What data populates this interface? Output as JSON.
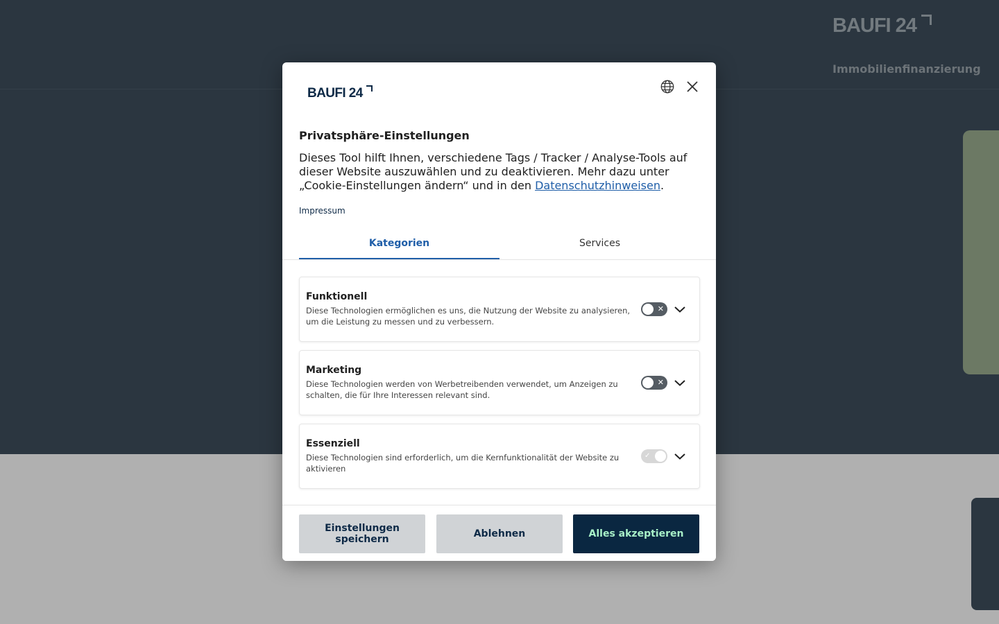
{
  "background": {
    "brand": "BAUFI 24",
    "nav_item": "Immobilienfinanzierung",
    "colors": {
      "hero": "#2b3640",
      "lower": "#b0b0b0",
      "side_panel": "#6c7964"
    }
  },
  "modal": {
    "brand": "BAUFI 24",
    "title": "Privatsphäre-Einstellungen",
    "description_before": "Dieses Tool hilft Ihnen, verschiedene Tags / Tracker / Analyse-Tools auf dieser Website auszuwählen und zu deaktivieren. Mehr dazu unter „Cookie-Einstellungen ändern“ und in den ",
    "description_link": "Datenschutzhinweisen",
    "description_after": ".",
    "impressum": "Impressum",
    "icons": {
      "language": "globe-icon",
      "close": "close-icon"
    },
    "tabs": [
      {
        "label": "Kategorien",
        "active": true
      },
      {
        "label": "Services",
        "active": false
      }
    ],
    "categories": [
      {
        "title": "Funktionell",
        "text": "Diese Technologien ermöglichen es uns, die Nutzung der Website zu analysieren, um die Leistung zu messen und zu verbessern.",
        "enabled": false,
        "locked": false
      },
      {
        "title": "Marketing",
        "text": "Diese Technologien werden von Werbetreibenden verwendet, um Anzeigen zu schalten, die für Ihre Interessen relevant sind.",
        "enabled": false,
        "locked": false
      },
      {
        "title": "Essenziell",
        "text": "Diese Technologien sind erforderlich, um die Kernfunktionalität der Website zu aktivieren",
        "enabled": true,
        "locked": true
      }
    ],
    "buttons": {
      "save": "Einstellungen speichern",
      "reject": "Ablehnen",
      "accept": "Alles akzeptieren"
    },
    "colors": {
      "accent": "#1f5ea8",
      "primary_button": "#0a2741",
      "primary_button_text": "#a8f0c8",
      "secondary_button": "#d0d3d6"
    }
  }
}
